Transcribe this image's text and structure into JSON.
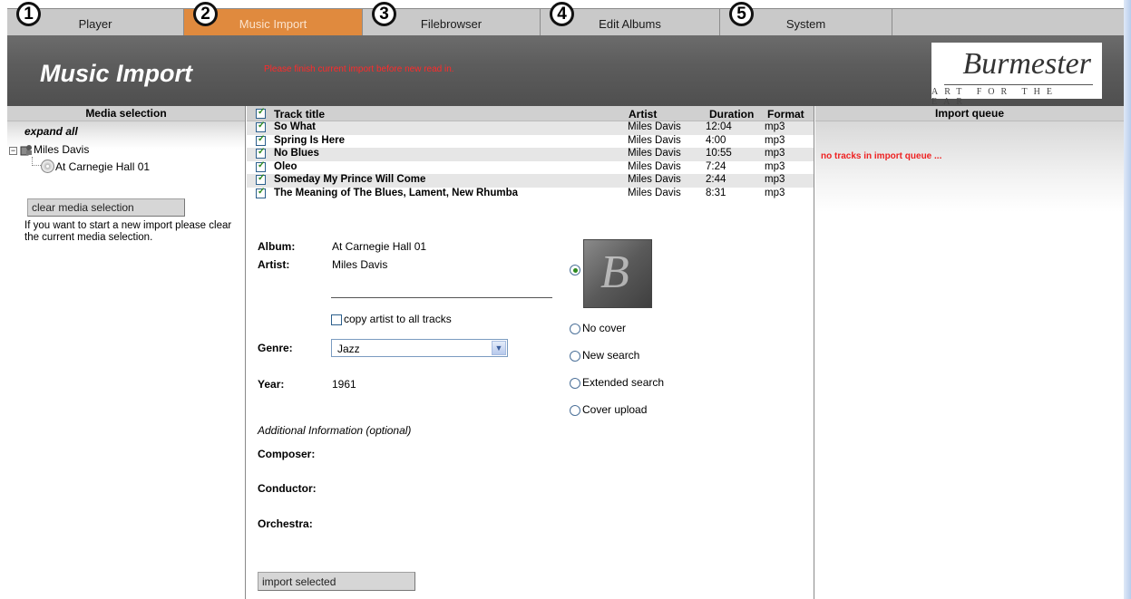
{
  "tabs": [
    {
      "number": "1",
      "label": "Player",
      "active": false
    },
    {
      "number": "2",
      "label": "Music Import",
      "active": true
    },
    {
      "number": "3",
      "label": "Filebrowser",
      "active": false
    },
    {
      "number": "4",
      "label": "Edit Albums",
      "active": false
    },
    {
      "number": "5",
      "label": "System",
      "active": false
    }
  ],
  "header": {
    "title": "Music Import",
    "notice": "Please finish current import before new read in.",
    "logo_word": "Burmester",
    "logo_tagline": "ART FOR THE EAR"
  },
  "media_selection": {
    "heading": "Media selection",
    "expand_all": "expand all",
    "tree_toggle": "−",
    "artist": "Miles Davis",
    "album": "At Carnegie Hall 01",
    "clear_button": "clear media selection",
    "hint": "If you want to start a new import please clear the current media selection."
  },
  "tracks": {
    "headers": {
      "title": "Track title",
      "artist": "Artist",
      "duration": "Duration",
      "format": "Format"
    },
    "all_checked": true,
    "rows": [
      {
        "title": "So What",
        "artist": "Miles Davis",
        "duration": "12:04",
        "format": "mp3",
        "checked": true
      },
      {
        "title": "Spring Is Here",
        "artist": "Miles Davis",
        "duration": "4:00",
        "format": "mp3",
        "checked": true
      },
      {
        "title": "No Blues",
        "artist": "Miles Davis",
        "duration": "10:55",
        "format": "mp3",
        "checked": true
      },
      {
        "title": "Oleo",
        "artist": "Miles Davis",
        "duration": "7:24",
        "format": "mp3",
        "checked": true
      },
      {
        "title": "Someday My Prince Will Come",
        "artist": "Miles Davis",
        "duration": "2:44",
        "format": "mp3",
        "checked": true
      },
      {
        "title": "The Meaning of The Blues, Lament, New Rhumba",
        "artist": "Miles Davis",
        "duration": "8:31",
        "format": "mp3",
        "checked": true
      }
    ]
  },
  "form": {
    "album_label": "Album:",
    "album_value": "At Carnegie Hall 01",
    "artist_label": "Artist:",
    "artist_value": "Miles Davis",
    "artist_input_value": "",
    "copy_artist_label": "copy artist to all tracks",
    "copy_artist_checked": false,
    "genre_label": "Genre:",
    "genre_value": "Jazz",
    "year_label": "Year:",
    "year_value": "1961",
    "additional_info": "Additional Information (optional)",
    "composer_label": "Composer:",
    "conductor_label": "Conductor:",
    "orchestra_label": "Orchestra:",
    "import_button": "import selected"
  },
  "cover": {
    "thumb_letter": "B",
    "selected_option": "current",
    "options": [
      "No cover",
      "New search",
      "Extended search",
      "Cover upload"
    ]
  },
  "import_queue": {
    "heading": "Import queue",
    "empty_text": "no tracks in import queue ..."
  },
  "colors": {
    "active_tab": "#e08a3e",
    "notice_red": "#ff2a2a",
    "checkbox_green": "#2c8a1e"
  }
}
